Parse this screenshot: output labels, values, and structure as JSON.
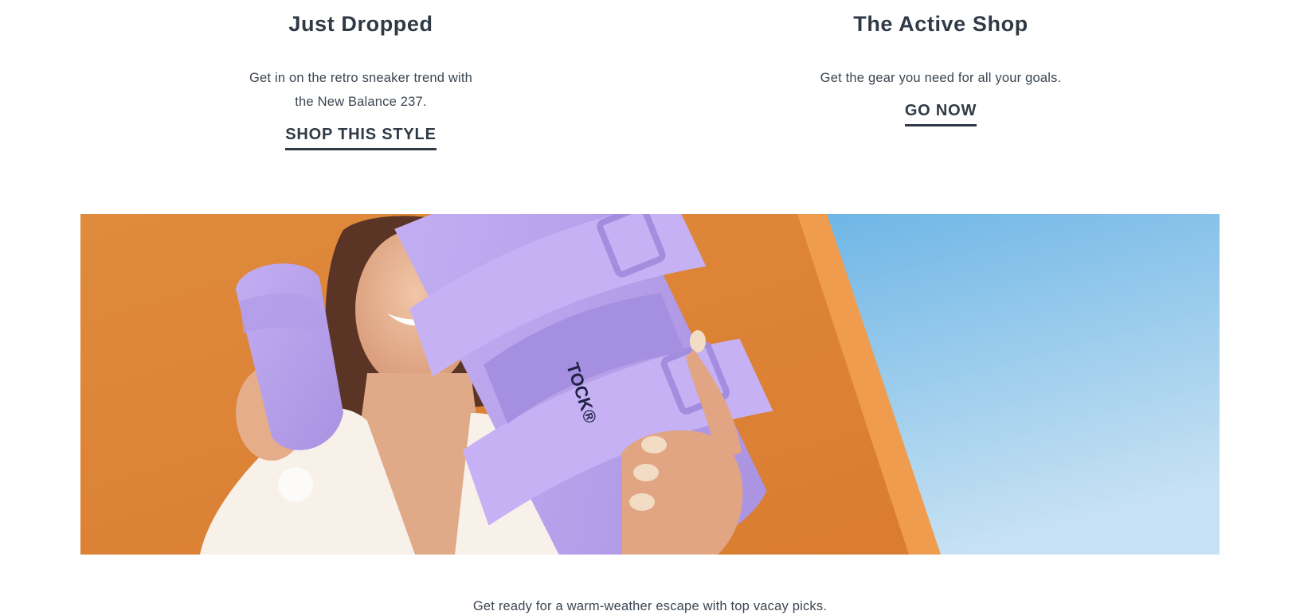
{
  "promos": [
    {
      "title": "Just Dropped",
      "description": "Get in on the retro sneaker trend with the New Balance 237.",
      "link_label": "SHOP THIS STYLE"
    },
    {
      "title": "The Active Shop",
      "description": "Get the gear you need for all your goals.",
      "link_label": "GO NOW"
    }
  ],
  "hero": {
    "brand_mark": "TOCK®",
    "colors": {
      "wall": "#e1893e",
      "sky": "#8cc6ec",
      "sandal": "#b9a2ec"
    }
  },
  "caption": "Get ready for a warm-weather escape with top vacay picks."
}
